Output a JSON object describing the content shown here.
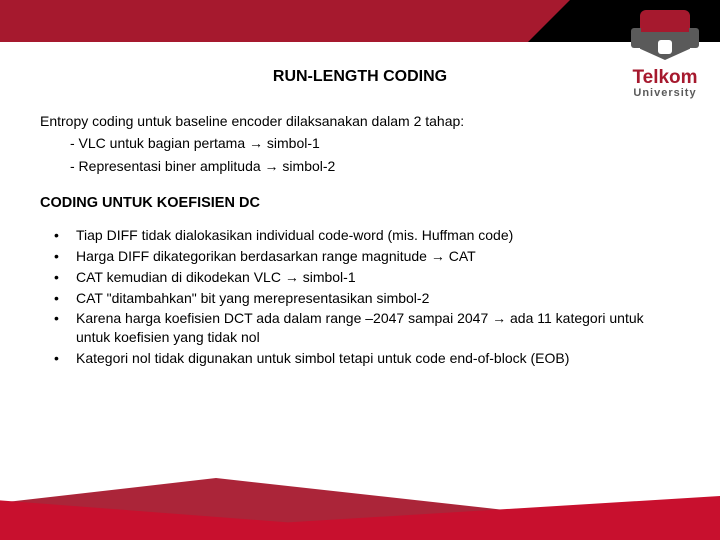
{
  "brand": {
    "name": "Telkom",
    "sub": "University"
  },
  "title": "RUN-LENGTH CODING",
  "intro": {
    "line1": "Entropy coding untuk baseline encoder dilaksanakan dalam 2 tahap:",
    "line2": "- VLC untuk bagian pertama → simbol-1",
    "line3": "- Representasi biner amplituda → simbol-2"
  },
  "subhead": "CODING UNTUK KOEFISIEN DC",
  "bullets": [
    "Tiap DIFF tidak dialokasikan individual code-word (mis. Huffman code)",
    "Harga DIFF dikategorikan berdasarkan range magnitude → CAT",
    "CAT kemudian di dikodekan VLC → simbol-1",
    "CAT \"ditambahkan\" bit yang merepresentasikan simbol-2",
    "Karena harga koefisien DCT ada dalam range –2047 sampai 2047\n→ ada 11 kategori untuk untuk koefisien yang tidak nol",
    "Kategori nol tidak digunakan untuk simbol tetapi untuk code end-of-block (EOB)"
  ]
}
